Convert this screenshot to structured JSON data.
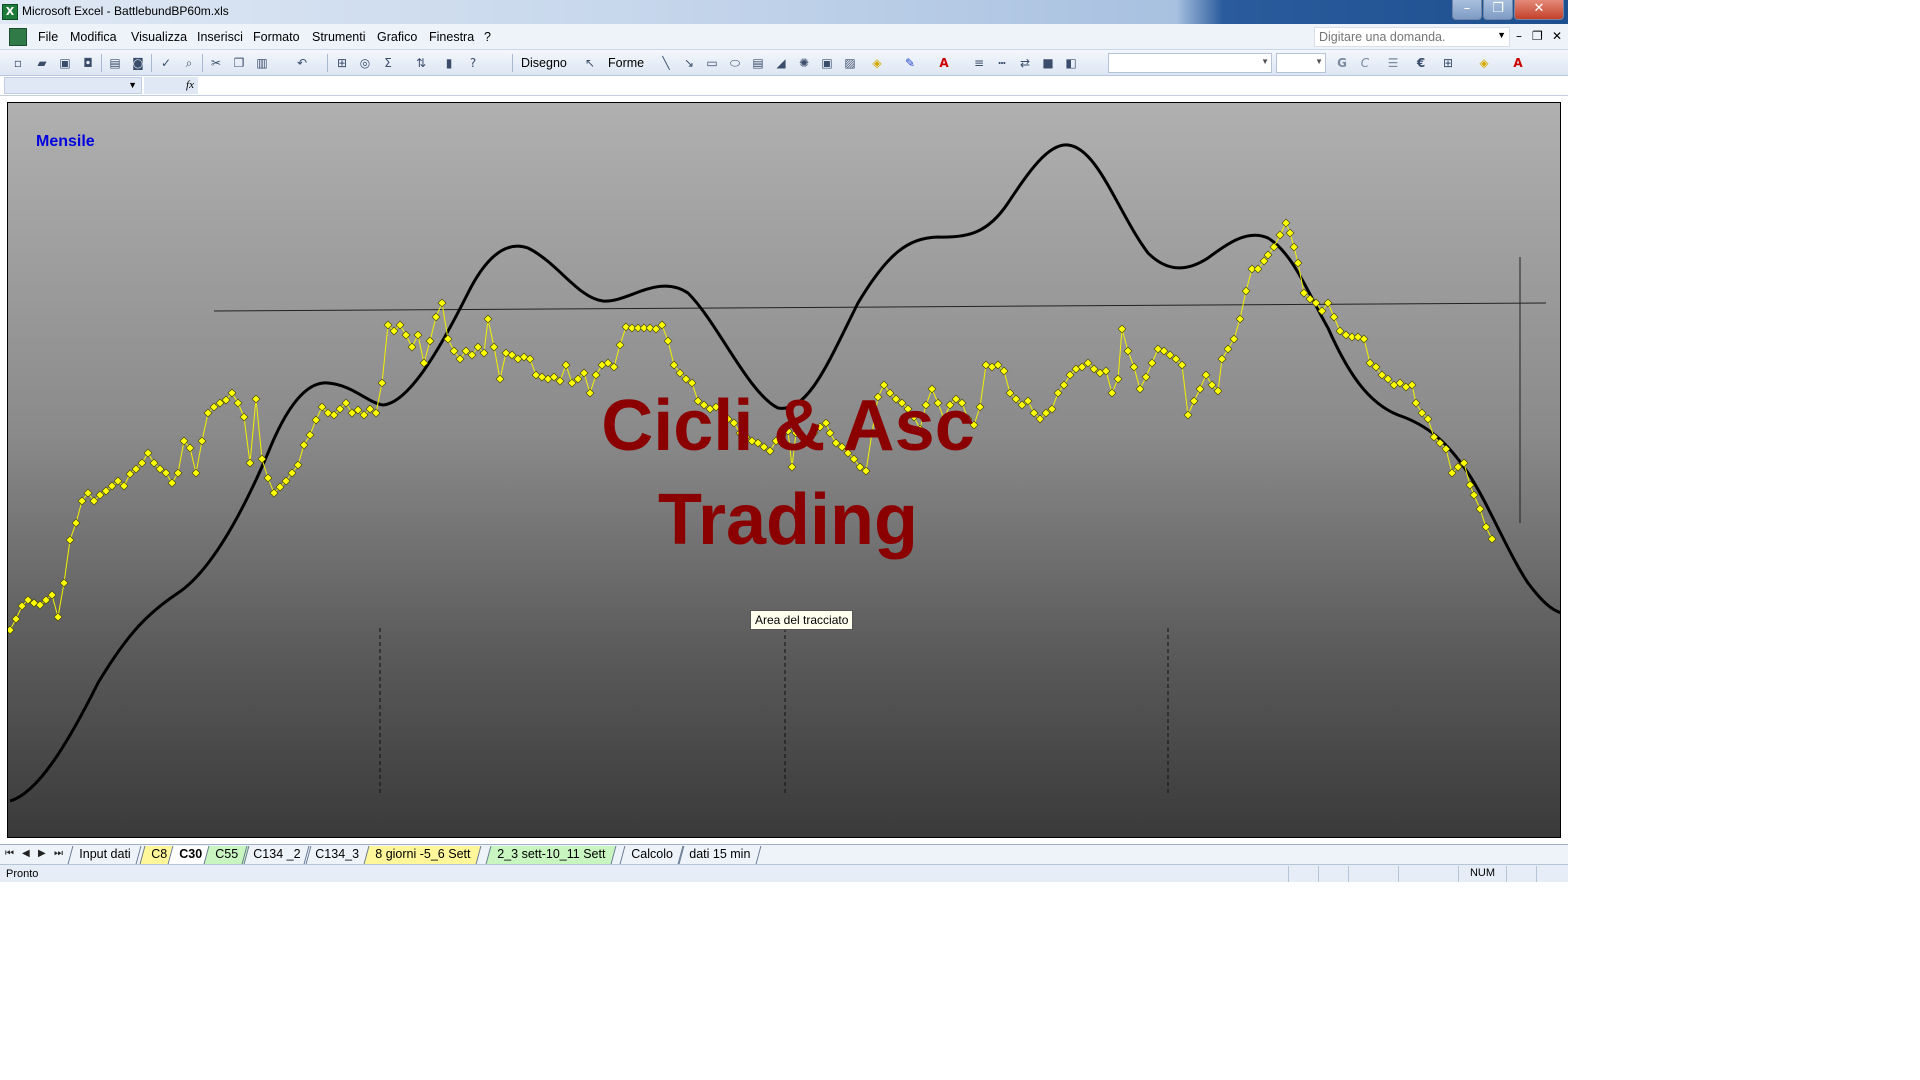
{
  "window": {
    "title": "Microsoft Excel - BattlebundBP60m.xls",
    "app_icon": "excel-icon",
    "controls": {
      "minimize": "–",
      "maximize": "❐",
      "close": "✕"
    }
  },
  "menu": {
    "items": [
      "File",
      "Modifica",
      "Visualizza",
      "Inserisci",
      "Formato",
      "Strumenti",
      "Grafico",
      "Finestra",
      "?"
    ],
    "help_placeholder": "Digitare una domanda.",
    "mdi": {
      "minimize": "–",
      "restore": "❐",
      "close": "✕"
    }
  },
  "toolbar": {
    "disegno_label": "Disegno",
    "forme_label": "Forme",
    "icons": [
      "new-icon",
      "open-icon",
      "save-icon",
      "permission-icon",
      "print-icon",
      "print-preview-icon",
      "spelling-icon",
      "research-icon",
      "cut-icon",
      "copy-icon",
      "paste-icon",
      "undo-icon",
      "chart-wizard-icon",
      "autosum-icon",
      "sort-icon",
      "help-icon"
    ],
    "bold_label": "G",
    "italic_label": "C",
    "euro_label": "€"
  },
  "formula_bar": {
    "fx_label": "fx"
  },
  "chart": {
    "title": "Mensile",
    "watermark_line1": "Cicli & Asc",
    "watermark_line2": "Trading",
    "tooltip": "Area del tracciato",
    "colors": {
      "price_line": "#f2f200",
      "price_marker": "#ffff00",
      "cycle_line": "#000000",
      "watermark": "#8b0000",
      "title": "#0000e0"
    }
  },
  "sheet_tabs": [
    {
      "label": "Input dati",
      "color": ""
    },
    {
      "label": "C8",
      "color": "#fff79a"
    },
    {
      "label": "C30",
      "color": "",
      "active": true
    },
    {
      "label": "C55",
      "color": "#c8f5c0"
    },
    {
      "label": "C134 _2",
      "color": ""
    },
    {
      "label": "C134_3",
      "color": ""
    },
    {
      "label": "8 giorni -5_6 Sett",
      "color": "#fff79a"
    },
    {
      "label": "2_3 sett-10_11 Sett",
      "color": "#c8f5c0"
    },
    {
      "label": "Calcolo",
      "color": ""
    },
    {
      "label": "dati 15 min",
      "color": ""
    }
  ],
  "status": {
    "text": "Pronto",
    "num": "NUM"
  }
}
